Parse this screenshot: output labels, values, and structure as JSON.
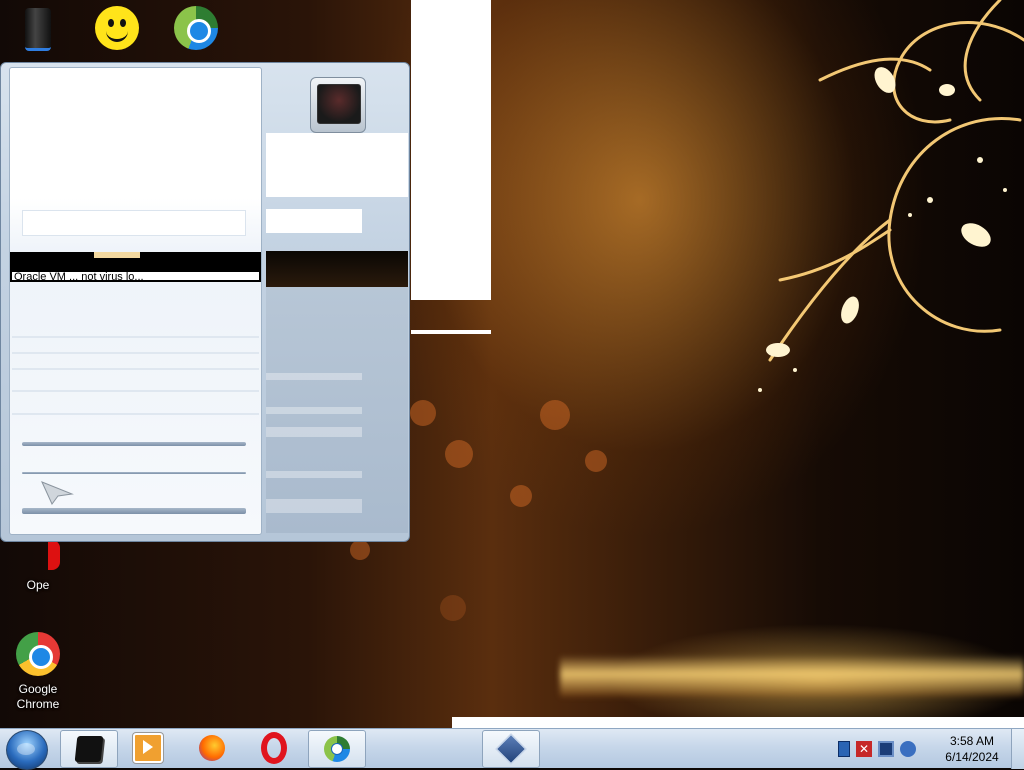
{
  "desktop": {
    "icons": [
      {
        "label": "Google Chrome"
      },
      {
        "label": "Ope"
      }
    ]
  },
  "window": {
    "caption": "Oracle VM ... not virus lo..."
  },
  "taskbar": {
    "buttons": [
      "start-orb",
      "black-box-app",
      "media-player",
      "firefox",
      "opera",
      "browser-active",
      "virtualbox"
    ]
  },
  "tray": {
    "icons": [
      "network-icon",
      "error-x-icon",
      "monitor-icon",
      "speaker-icon"
    ]
  },
  "clock": {
    "time": "3:58 AM",
    "date": "6/14/2024"
  }
}
